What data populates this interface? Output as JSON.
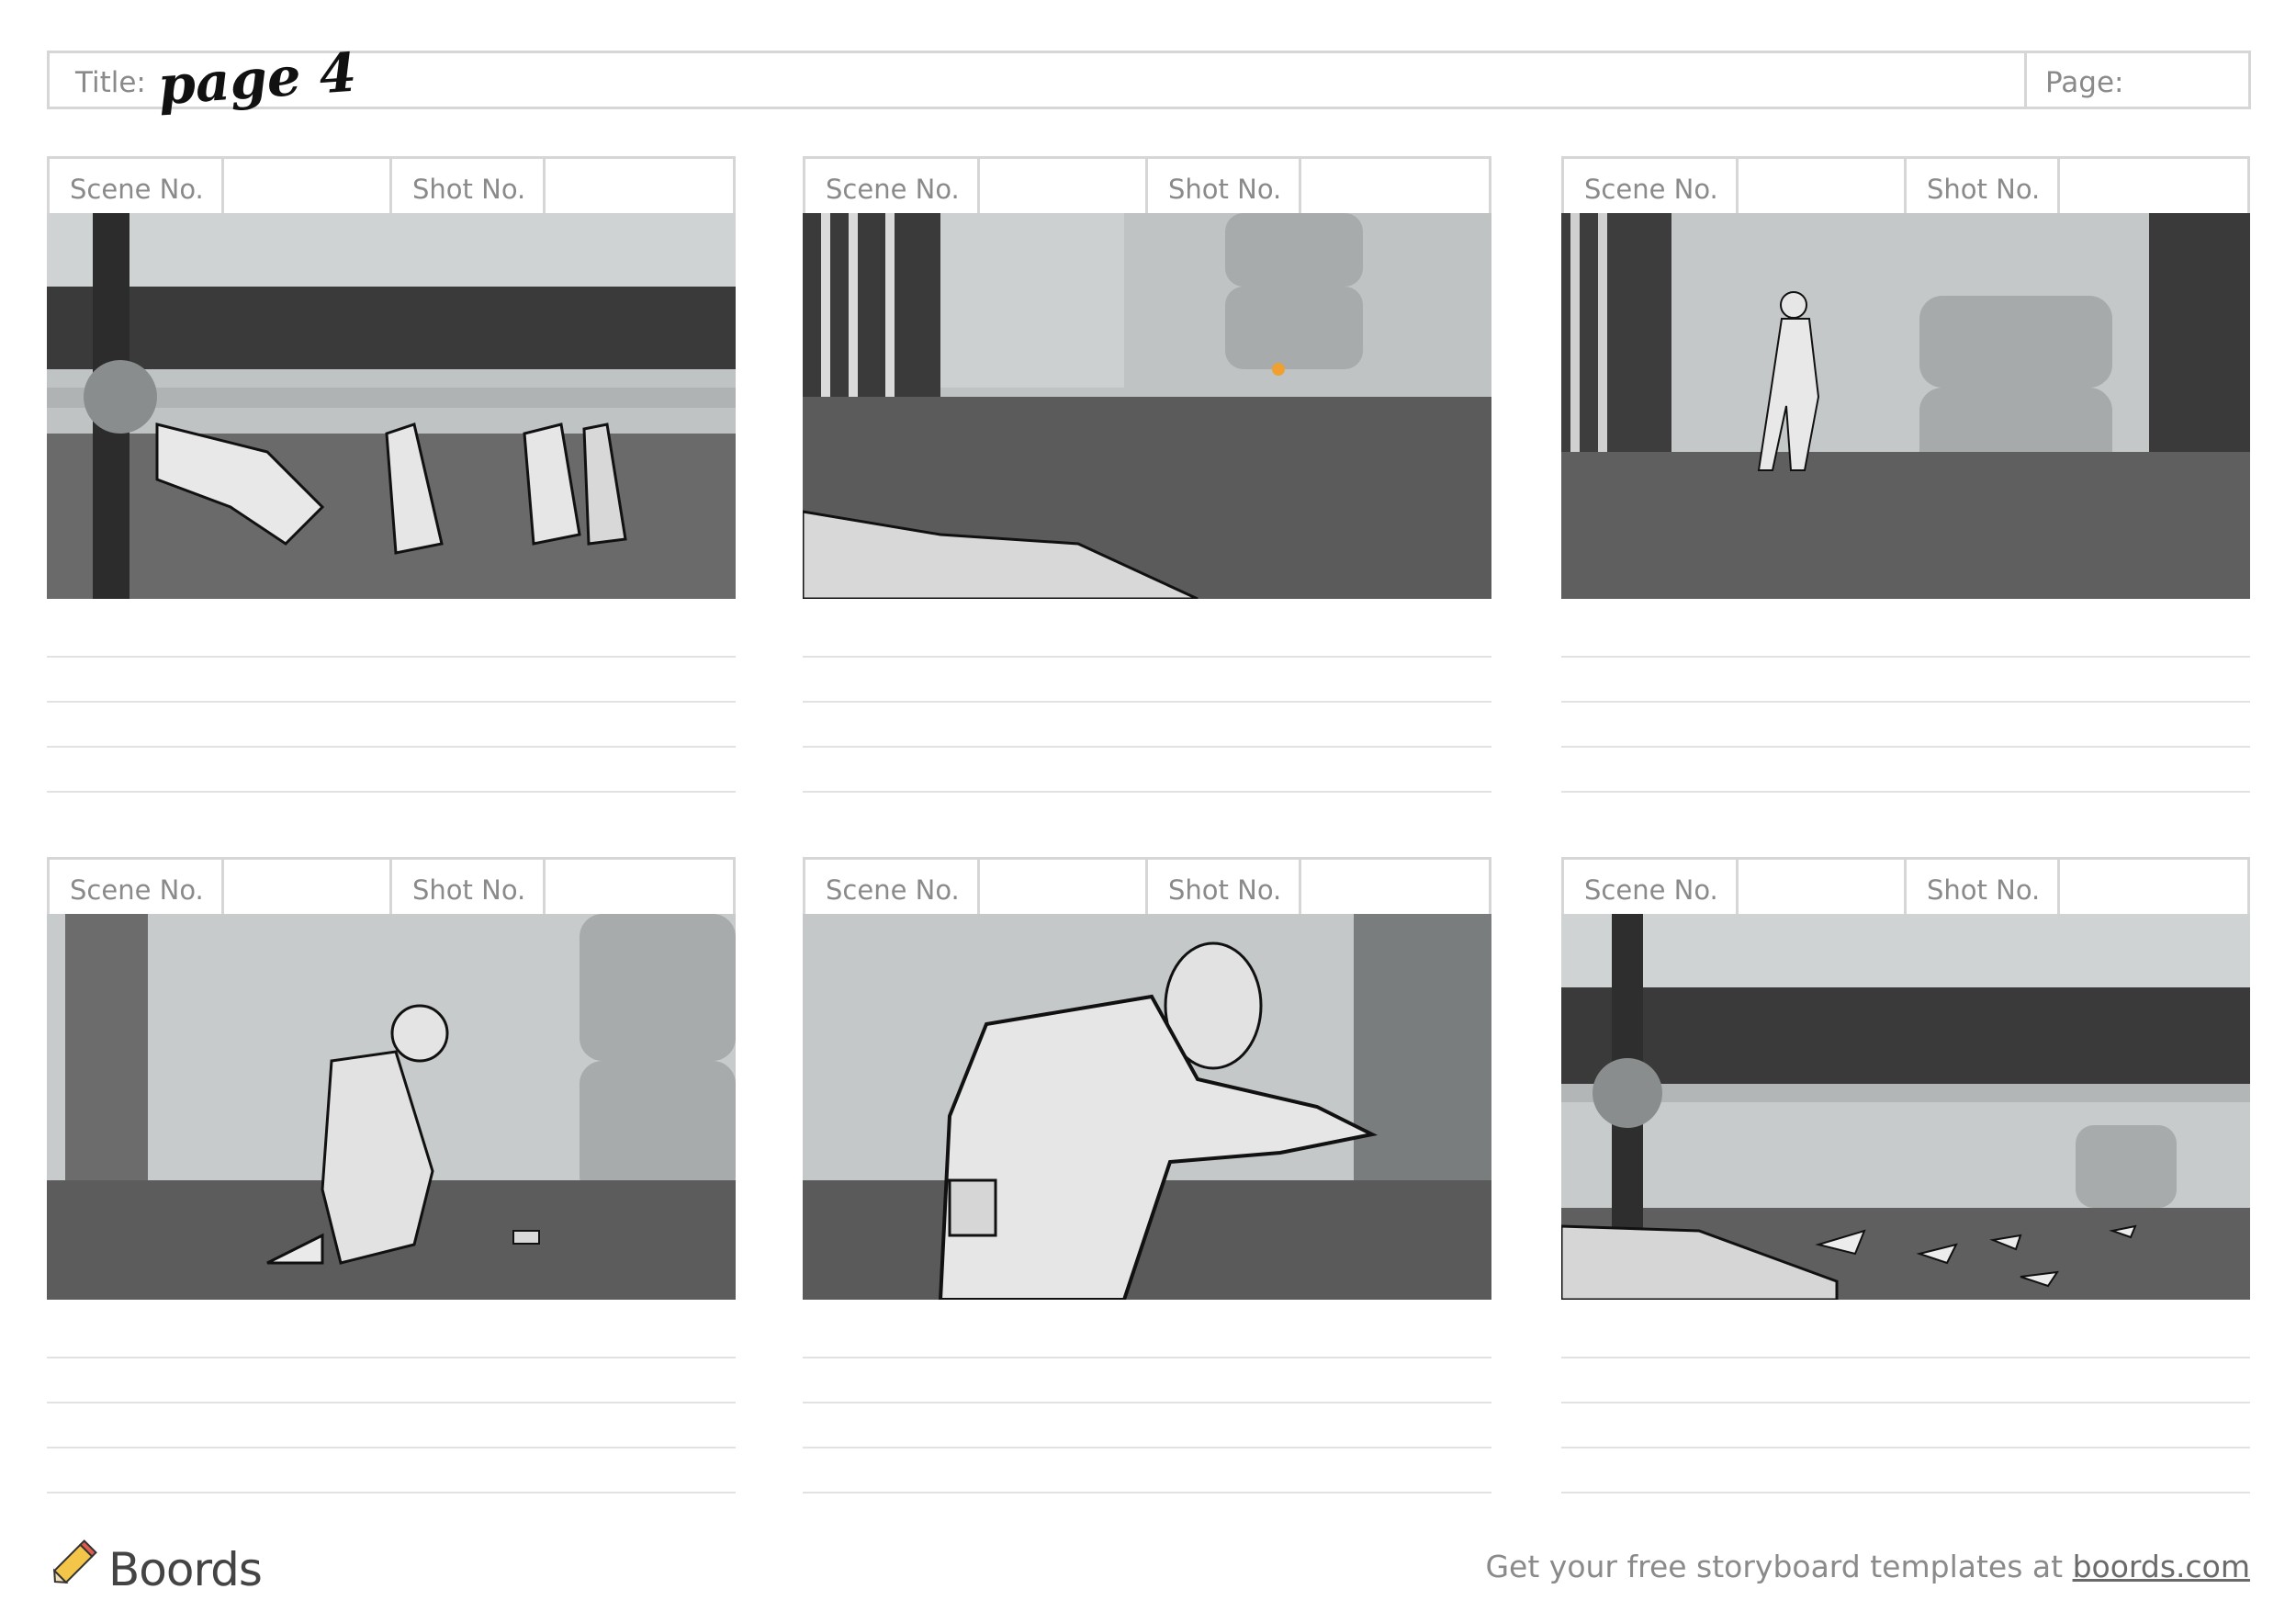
{
  "header": {
    "title_label": "Title:",
    "title_value": "page 4",
    "page_label": "Page:",
    "page_value": ""
  },
  "panel_labels": {
    "scene": "Scene No.",
    "shot": "Shot No."
  },
  "panels": [
    {
      "scene_no": "",
      "shot_no": "",
      "description": ""
    },
    {
      "scene_no": "",
      "shot_no": "",
      "description": ""
    },
    {
      "scene_no": "",
      "shot_no": "",
      "description": ""
    },
    {
      "scene_no": "",
      "shot_no": "",
      "description": ""
    },
    {
      "scene_no": "",
      "shot_no": "",
      "description": ""
    },
    {
      "scene_no": "",
      "shot_no": "",
      "description": ""
    }
  ],
  "footer": {
    "brand": "Boords",
    "note": "Get your free storyboard templates at",
    "link": "boords.com"
  },
  "colors": {
    "border": "#d6d6d6",
    "label": "#8a8a8a",
    "accent_orange": "#f0a030"
  }
}
